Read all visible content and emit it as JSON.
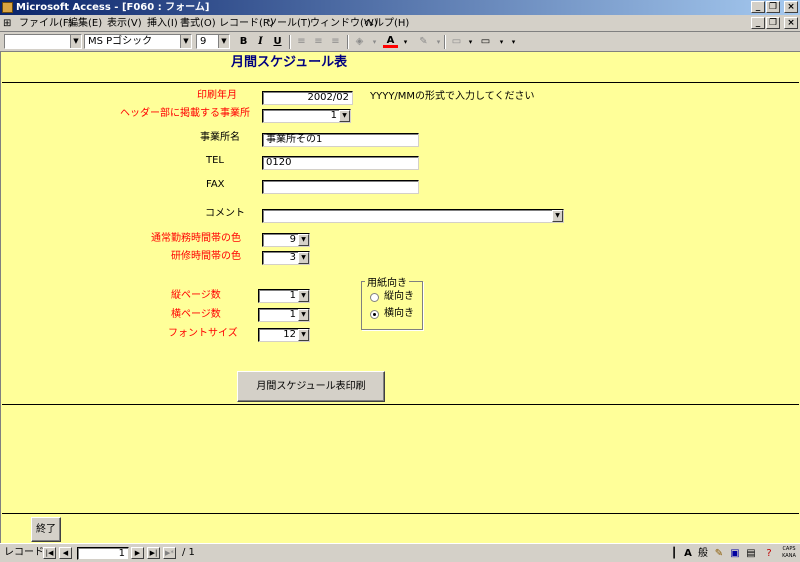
{
  "window": {
    "title": "Microsoft Access - [F060 : フォーム]"
  },
  "menu": {
    "items": [
      "ファイル(F)",
      "編集(E)",
      "表示(V)",
      "挿入(I)",
      "書式(O)",
      "レコード(R)",
      "ツール(T)",
      "ウィンドウ(W)",
      "ヘルプ(H)"
    ]
  },
  "toolbar": {
    "object_combo": "",
    "font_name": "MS Pゴシック",
    "font_size": "9",
    "bold": "B",
    "italic": "I",
    "underline": "U"
  },
  "form": {
    "title": "月間スケジュール表",
    "print_month_label": "印刷年月",
    "print_month_value": "2002/02",
    "print_month_hint": "YYYY/MMの形式で入力してください",
    "header_office_label": "ヘッダー部に掲載する事業所",
    "header_office_value": "1",
    "office_name_label": "事業所名",
    "office_name_value": "事業所その1",
    "tel_label": "TEL",
    "tel_value": "0120",
    "fax_label": "FAX",
    "fax_value": "",
    "comment_label": "コメント",
    "comment_value": "",
    "normal_hours_color_label": "通常勤務時間帯の色",
    "normal_hours_color_value": "9",
    "training_hours_color_label": "研修時間帯の色",
    "training_hours_color_value": "3",
    "vertical_pages_label": "縦ページ数",
    "vertical_pages_value": "1",
    "horizontal_pages_label": "横ページ数",
    "horizontal_pages_value": "1",
    "font_size_label": "フォントサイズ",
    "font_size_value": "12",
    "orientation": {
      "group_label": "用紙向き",
      "portrait_label": "縦向き",
      "landscape_label": "横向き",
      "selected": "横向き"
    },
    "print_button_label": "月間スケジュール表印刷",
    "exit_button_label": "終了"
  },
  "statusbar": {
    "record_label": "レコード:",
    "record_number": "1",
    "record_total": "/ 1",
    "ime_label": "般",
    "caps": "CAPS",
    "kana": "KANA"
  },
  "colors": {
    "form_background": "#ffff99",
    "label_red": "#ff0000",
    "titlebar_start": "#0a246a",
    "titlebar_end": "#a6caf0"
  }
}
